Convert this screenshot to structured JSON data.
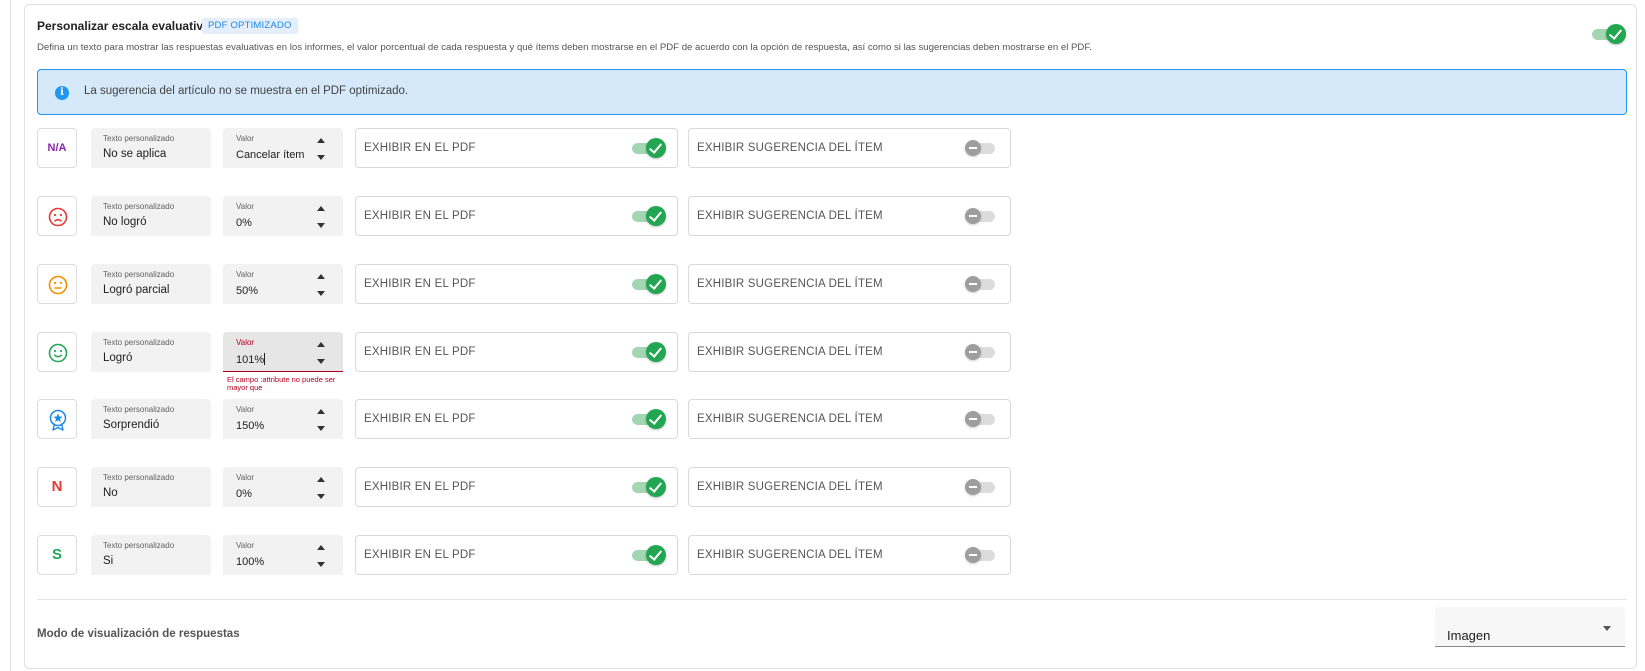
{
  "header": {
    "title": "Personalizar escala evaluativa",
    "badge": "PDF OPTIMIZADO",
    "description": "Defina un texto para mostrar las respuestas evaluativas en los informes, el valor porcentual de cada respuesta y qué ítems deben mostrarse en el PDF de acuerdo con la opción de respuesta, así como si las sugerencias deben mostrarse en el PDF.",
    "enabled": true
  },
  "info": {
    "icon": "info-icon",
    "glyph": "i",
    "text": "La sugerencia del artículo no se muestra en el PDF optimizado."
  },
  "labels": {
    "text_field": "Texto personalizado",
    "value_field": "Valor",
    "show_pdf": "EXHIBIR EN EL PDF",
    "show_suggestion": "EXHIBIR SUGERENCIA DEL ÍTEM"
  },
  "rows": [
    {
      "icon": "na-icon",
      "glyph": "N/A",
      "color": "#8e24aa",
      "text": "No se aplica",
      "value": "Cancelar ítem",
      "show_pdf": true,
      "show_suggestion": false
    },
    {
      "icon": "sad-face-icon",
      "color": "#e53935",
      "text": "No logró",
      "value": "0%",
      "show_pdf": true,
      "show_suggestion": false
    },
    {
      "icon": "neutral-face-icon",
      "color": "#fb8c00",
      "text": "Logró parcial",
      "value": "50%",
      "show_pdf": true,
      "show_suggestion": false
    },
    {
      "icon": "happy-face-icon",
      "color": "#26a65b",
      "text": "Logró",
      "value": "101%",
      "show_pdf": true,
      "show_suggestion": false,
      "error": "El campo :attribute no puede ser mayor que"
    },
    {
      "icon": "award-star-icon",
      "color": "#1e88e5",
      "text": "Sorprendió",
      "value": "150%",
      "show_pdf": true,
      "show_suggestion": false
    },
    {
      "icon": "letter-n-icon",
      "glyph": "N",
      "color": "#e53935",
      "text": "No",
      "value": "0%",
      "show_pdf": true,
      "show_suggestion": false
    },
    {
      "icon": "letter-s-icon",
      "glyph": "S",
      "color": "#26a65b",
      "text": "Si",
      "value": "100%",
      "show_pdf": true,
      "show_suggestion": false
    }
  ],
  "display_mode": {
    "label": "Modo de visualización de respuestas",
    "value": "Imagen"
  },
  "colors": {
    "accent_green": "#22a652",
    "info_blue": "#2196f3",
    "error_red": "#b00020"
  }
}
